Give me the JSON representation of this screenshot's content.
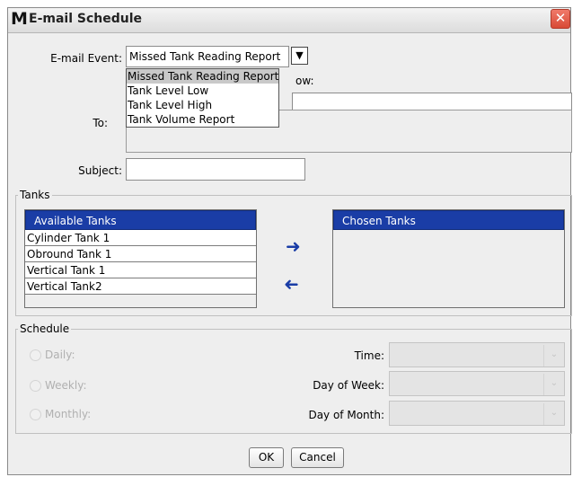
{
  "window": {
    "title": "E-mail Schedule",
    "logo": "M",
    "close_icon": "close-x-icon"
  },
  "email_event": {
    "label": "E-mail Event:",
    "value": "Missed Tank Reading Report",
    "options": [
      "Missed Tank Reading Report",
      "Tank Level Low",
      "Tank Level High",
      "Tank Volume Report"
    ],
    "hidden_label_fragment": "ow:"
  },
  "to": {
    "label": "To:"
  },
  "subject": {
    "label": "Subject:"
  },
  "tanks": {
    "legend": "Tanks",
    "available_header": "Available Tanks",
    "available": [
      "Cylinder Tank 1",
      "Obround Tank 1",
      "Vertical Tank 1",
      "Vertical Tank2"
    ],
    "chosen_header": "Chosen Tanks",
    "add_icon": "arrow-right-icon",
    "remove_icon": "arrow-left-icon"
  },
  "schedule": {
    "legend": "Schedule",
    "daily": "Daily:",
    "weekly": "Weekly:",
    "monthly": "Monthly:",
    "time_label": "Time:",
    "day_of_week_label": "Day of Week:",
    "day_of_month_label": "Day of Month:"
  },
  "buttons": {
    "ok": "OK",
    "cancel": "Cancel"
  },
  "colors": {
    "header_blue": "#1a3da6",
    "close_red": "#d84a36"
  }
}
